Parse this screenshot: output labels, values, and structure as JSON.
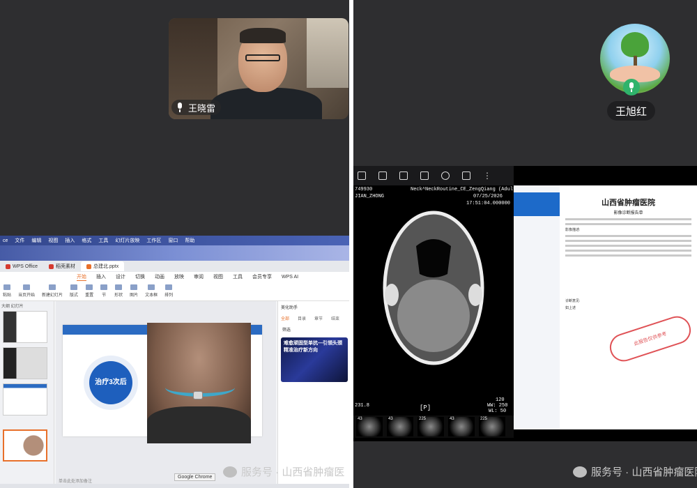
{
  "left": {
    "participant_name": "王晓雷",
    "menubar": [
      "ce",
      "文件",
      "编辑",
      "视图",
      "插入",
      "格式",
      "工具",
      "幻灯片放映",
      "工作区",
      "窗口",
      "帮助"
    ],
    "tabs": [
      {
        "label": "WPS Office",
        "color": "#d53a2f"
      },
      {
        "label": "稻壳素材",
        "color": "#d53a2f"
      },
      {
        "label": "总建北.pptx",
        "color": "#e8702a"
      }
    ],
    "ribbon_tabs": [
      "开始",
      "插入",
      "设计",
      "切换",
      "动画",
      "放映",
      "审阅",
      "视图",
      "工具",
      "会员专享",
      "WPS AI"
    ],
    "ribbon_buttons": [
      "粘贴",
      "当页开始",
      "新建幻灯片",
      "版式",
      "重置",
      "节",
      "形状",
      "图片",
      "文本框",
      "排列"
    ],
    "thumbs_label": "大纲 幻灯片",
    "slide_circle_text": "治疗3次后",
    "right_panel": {
      "title": "美化助手",
      "tabs": [
        "全部",
        "目录",
        "章节",
        "结束"
      ],
      "filter": "筛选",
      "card_text": "难愈顽固型单抗—引领头颈精准治疗新方向"
    },
    "chrome_tip": "Google Chrome",
    "status_hint": "单击此处添加备注",
    "watermark": "服务号 · 山西省肿瘤医"
  },
  "right": {
    "participant_name": "王旭红",
    "ct": {
      "id": "749930",
      "patient": "JIAN_ZHONG",
      "protocol": "Neck^NeckRoutine_CE_ZengQiang (Adult)",
      "date": "07/25/2026",
      "time": "17:51:04.000000",
      "orientation": "[P]",
      "ww": "WW: 250",
      "wl": "WL: 50",
      "kv": "120",
      "scale": "231.8"
    },
    "thumb_labels": [
      "43",
      "43",
      "225",
      "43",
      "225"
    ],
    "report": {
      "hospital": "山西省肿瘤医院",
      "title": "影像诊断报告单",
      "section1": "影像描述:",
      "section2": "诊断意见:",
      "diagnosis": "如上述",
      "stamp": "此报告仅供参考"
    },
    "watermark": "服务号 · 山西省肿瘤医院"
  }
}
